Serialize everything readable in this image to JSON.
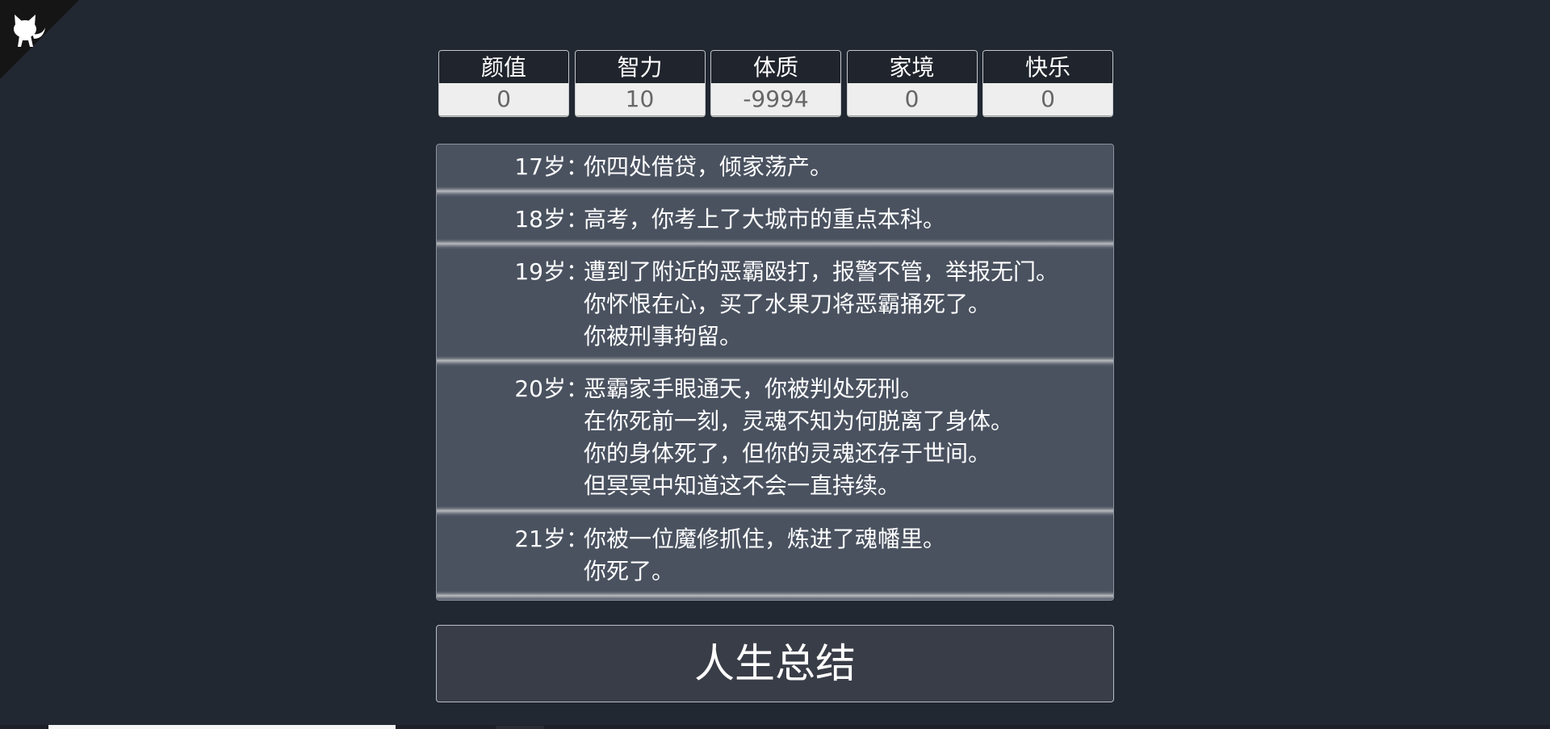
{
  "properties": [
    {
      "label": "颜值",
      "value": "0"
    },
    {
      "label": "智力",
      "value": "10"
    },
    {
      "label": "体质",
      "value": "-9994"
    },
    {
      "label": "家境",
      "value": "0"
    },
    {
      "label": "快乐",
      "value": "0"
    }
  ],
  "trajectory": [
    {
      "age": "17岁",
      "lines": [
        "你四处借贷，倾家荡产。"
      ]
    },
    {
      "age": "18岁",
      "lines": [
        "高考，你考上了大城市的重点本科。"
      ]
    },
    {
      "age": "19岁",
      "lines": [
        "遭到了附近的恶霸殴打，报警不管，举报无门。",
        "你怀恨在心，买了水果刀将恶霸捅死了。",
        "你被刑事拘留。"
      ]
    },
    {
      "age": "20岁",
      "lines": [
        "恶霸家手眼通天，你被判处死刑。",
        "在你死前一刻，灵魂不知为何脱离了身体。",
        "你的身体死了，但你的灵魂还存于世间。",
        "但冥冥中知道这不会一直持续。"
      ]
    },
    {
      "age": "21岁",
      "lines": [
        "你被一位魔修抓住，炼进了魂幡里。",
        "你死了。"
      ]
    }
  ],
  "age_separator": "：",
  "summary_button": "人生总结",
  "icons": {
    "corner": "github-octocat-icon"
  },
  "colors": {
    "background": "#222832",
    "panel": "#4a5260",
    "button": "#393d47"
  }
}
